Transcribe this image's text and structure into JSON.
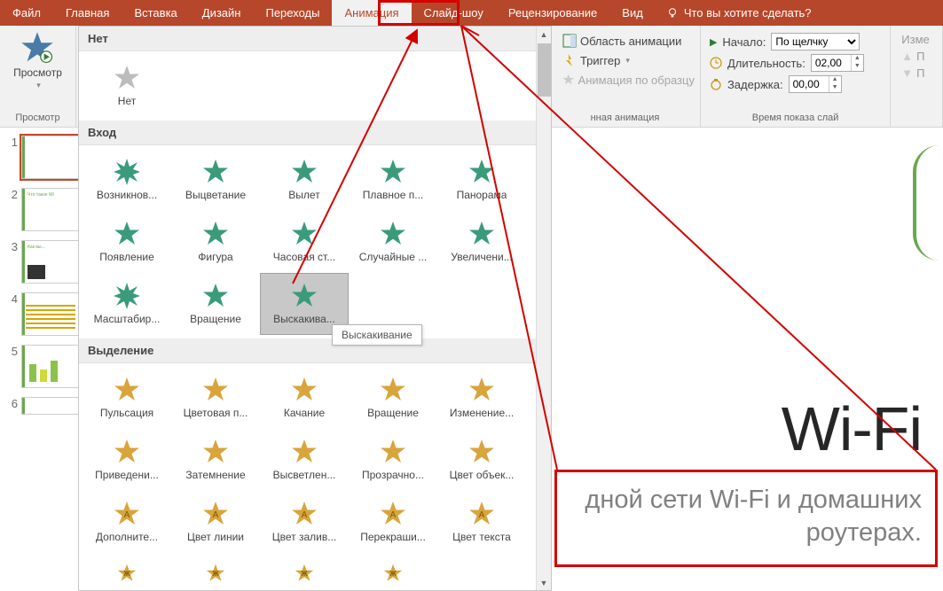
{
  "tabs": {
    "file": "Файл",
    "home": "Главная",
    "insert": "Вставка",
    "design": "Дизайн",
    "transitions": "Переходы",
    "animation": "Анимация",
    "slideshow": "Слайд-шоу",
    "review": "Рецензирование",
    "view": "Вид",
    "tellme": "Что вы хотите сделать?"
  },
  "ribbon": {
    "preview": {
      "button": "Просмотр",
      "group": "Просмотр"
    },
    "gallery": {
      "none_header": "Нет",
      "none_item": "Нет",
      "entrance_header": "Вход",
      "entrance": [
        "Возникнов...",
        "Выцветание",
        "Вылет",
        "Плавное п...",
        "Панорама",
        "Появление",
        "Фигура",
        "Часовая ст...",
        "Случайные ...",
        "Увеличени...",
        "Масштабир...",
        "Вращение",
        "Выскакива..."
      ],
      "emphasis_header": "Выделение",
      "emphasis": [
        "Пульсация",
        "Цветовая п...",
        "Качание",
        "Вращение",
        "Изменение...",
        "Приведени...",
        "Затемнение",
        "Высветлен...",
        "Прозрачно...",
        "Цвет объек...",
        "Дополните...",
        "Цвет линии",
        "Цвет залив...",
        "Перекраши...",
        "Цвет текста"
      ],
      "emphasis_extra": [
        "Ж",
        "Ж",
        "Ж",
        "Ж"
      ]
    },
    "tooltip": "Выскакивание",
    "advanced": {
      "pane": "Область анимации",
      "trigger": "Триггер",
      "painter": "Анимация по образцу",
      "group": "нная анимация"
    },
    "timing": {
      "start_label": "Начало:",
      "start_value": "По щелчку",
      "duration_label": "Длительность:",
      "duration_value": "02,00",
      "delay_label": "Задержка:",
      "delay_value": "00,00",
      "group": "Время показа слай"
    },
    "extra": {
      "row1": "Изме",
      "row2": "П",
      "row3": "П"
    }
  },
  "thumbs": {
    "t2_title": "Что такое Wi",
    "t3_title": "Как вы..."
  },
  "slide": {
    "title": "Wi-Fi",
    "sub1": "дной сети Wi-Fi и домашних",
    "sub2": "роутерах."
  }
}
